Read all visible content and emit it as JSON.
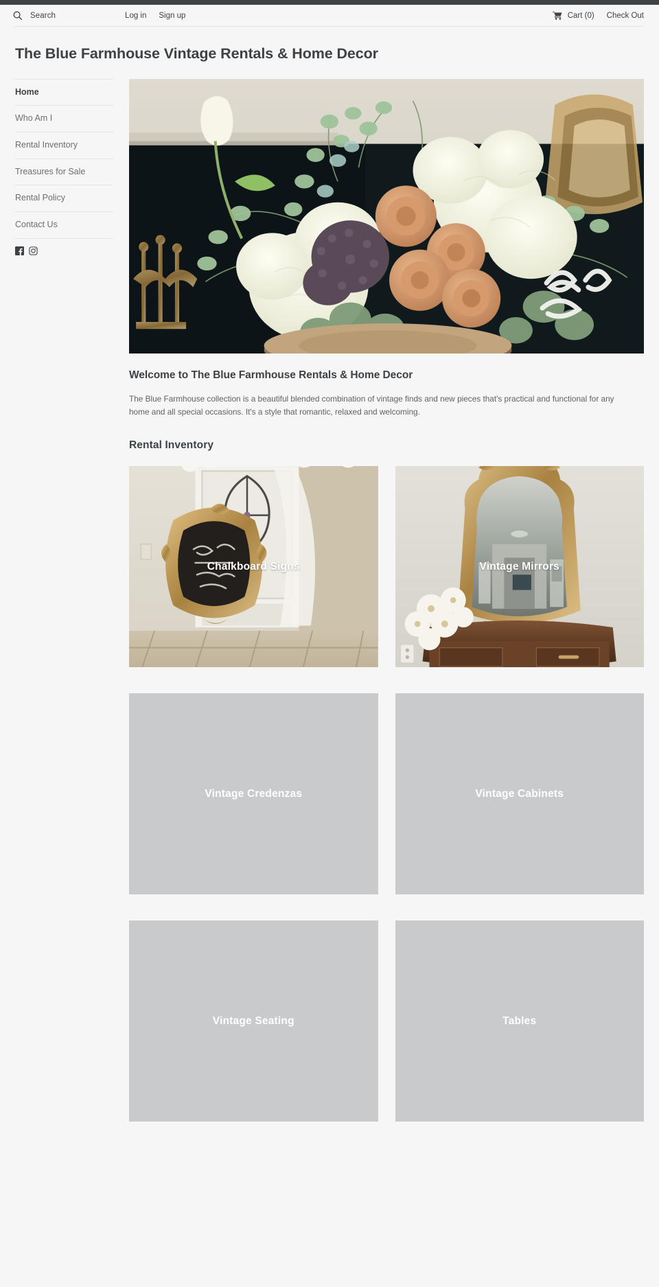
{
  "header": {
    "search": {
      "label": "Search",
      "icon": "search-icon"
    },
    "auth": [
      {
        "label": "Log in"
      },
      {
        "label": "Sign up"
      }
    ],
    "cart": {
      "label": "Cart (0)",
      "count": 0,
      "icon": "shopping-cart-icon"
    },
    "checkout": {
      "label": "Check Out"
    }
  },
  "site": {
    "title": "The Blue Farmhouse Vintage Rentals & Home Decor"
  },
  "sidebar": {
    "items": [
      {
        "label": "Home",
        "active": true
      },
      {
        "label": "Who Am I",
        "active": false
      },
      {
        "label": "Rental Inventory",
        "active": false
      },
      {
        "label": "Treasures for Sale",
        "active": false
      },
      {
        "label": "Rental Policy",
        "active": false
      },
      {
        "label": "Contact Us",
        "active": false
      }
    ],
    "social": [
      {
        "name": "facebook-icon",
        "label": "Facebook"
      },
      {
        "name": "instagram-icon",
        "label": "Instagram"
      }
    ]
  },
  "main": {
    "hero": {
      "alt": "Vintage floral centerpiece of white hydrangeas, peach roses and eucalyptus in a rustic wood box on a wood stump table"
    },
    "welcome": {
      "heading": "Welcome to The Blue Farmhouse Rentals & Home Decor",
      "body": " The Blue Farmhouse collection is a beautiful blended combination of vintage finds and new pieces that's practical and functional for any home and all special occasions. It's a style that romantic, relaxed and welcoming."
    },
    "inventory": {
      "heading": "Rental Inventory",
      "tiles": [
        {
          "label": "Chalkboard Signs",
          "has_image": true
        },
        {
          "label": "Vintage Mirrors",
          "has_image": true
        },
        {
          "label": "Vintage Credenzas",
          "has_image": false
        },
        {
          "label": "Vintage Cabinets",
          "has_image": false
        },
        {
          "label": "Vintage Seating",
          "has_image": false
        },
        {
          "label": "Tables",
          "has_image": false
        }
      ]
    }
  },
  "colors": {
    "page_background": "#f6f6f6",
    "text": "#3d4246",
    "muted_text": "#6b6f73",
    "rule": "#e4e4e4",
    "top_strip": "#3d4246",
    "tile_placeholder": "#c8cacc",
    "tile_label": "#ffffff"
  }
}
